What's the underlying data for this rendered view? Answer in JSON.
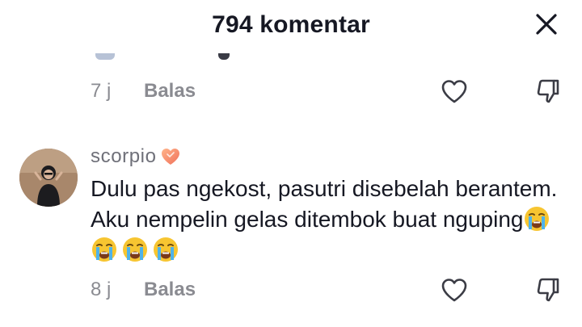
{
  "header": {
    "title": "794 komentar"
  },
  "comments": [
    {
      "time": "7 j",
      "reply_label": "Balas"
    },
    {
      "username": "scorpio",
      "text": "Dulu pas ngekost, pasutri disebelah berantem. Aku nempelin gelas ditembok buat nguping",
      "emoji": "loudly-crying-face",
      "emoji_count": 4,
      "time": "8 j",
      "reply_label": "Balas"
    }
  ],
  "colors": {
    "text": "#161823",
    "muted": "#8a8b91",
    "username": "#6f7079",
    "background": "#ffffff"
  }
}
